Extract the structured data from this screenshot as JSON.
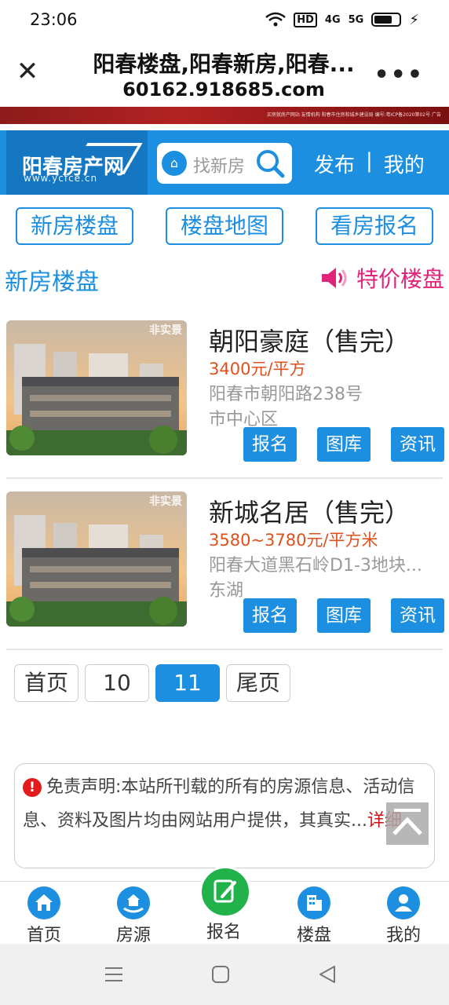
{
  "status_bar": {
    "time": "23:06",
    "network": "HD",
    "sig1": "4G",
    "sig2": "5G"
  },
  "browser": {
    "title": "阳春楼盘,阳春新房,阳春...",
    "url": "60162.918685.com",
    "more": "•••"
  },
  "banner": {
    "fine_print": "买房就房产网站 友情机构 阳春市住房和城乡建设局 编号:粤ICP备2020第02号 广告"
  },
  "site": {
    "logo_name": "阳春房产网",
    "logo_sub": "www.ycfce.cn",
    "search_placeholder": "找新房",
    "nav_publish": "发布",
    "nav_sep": "|",
    "nav_mine": "我的"
  },
  "quick_links": [
    {
      "label": "新房楼盘"
    },
    {
      "label": "楼盘地图"
    },
    {
      "label": "看房报名"
    }
  ],
  "section": {
    "title": "新房楼盘",
    "special": "特价楼盘"
  },
  "listings": [
    {
      "badge": "非实景",
      "name": "朝阳豪庭（售完）",
      "price": "3400元/平方",
      "address": "阳春市朝阳路238号",
      "district": "市中心区",
      "btn_signup": "报名",
      "btn_gallery": "图库",
      "btn_news": "资讯"
    },
    {
      "badge": "非实景",
      "name": "新城名居（售完）",
      "price": "3580~3780元/平方米",
      "address": "阳春大道黑石岭D1-3地块...",
      "district": "东湖",
      "btn_signup": "报名",
      "btn_gallery": "图库",
      "btn_news": "资讯"
    }
  ],
  "pager": {
    "first": "首页",
    "p10": "10",
    "p11": "11",
    "last": "尾页",
    "current": "11"
  },
  "disclaimer": {
    "warn_icon": "!",
    "text": "免责声明:本站所刊载的所有的房源信息、活动信息、资料及图片均由网站用户提供，其真实...",
    "detail": "详细"
  },
  "bottom_nav": [
    {
      "label": "首页"
    },
    {
      "label": "房源"
    },
    {
      "label": "报名"
    },
    {
      "label": "楼盘"
    },
    {
      "label": "我的"
    }
  ],
  "colors": {
    "primary": "#1d8fe0",
    "accent_pink": "#e0247a",
    "price": "#e0501c",
    "green": "#21b34a"
  }
}
